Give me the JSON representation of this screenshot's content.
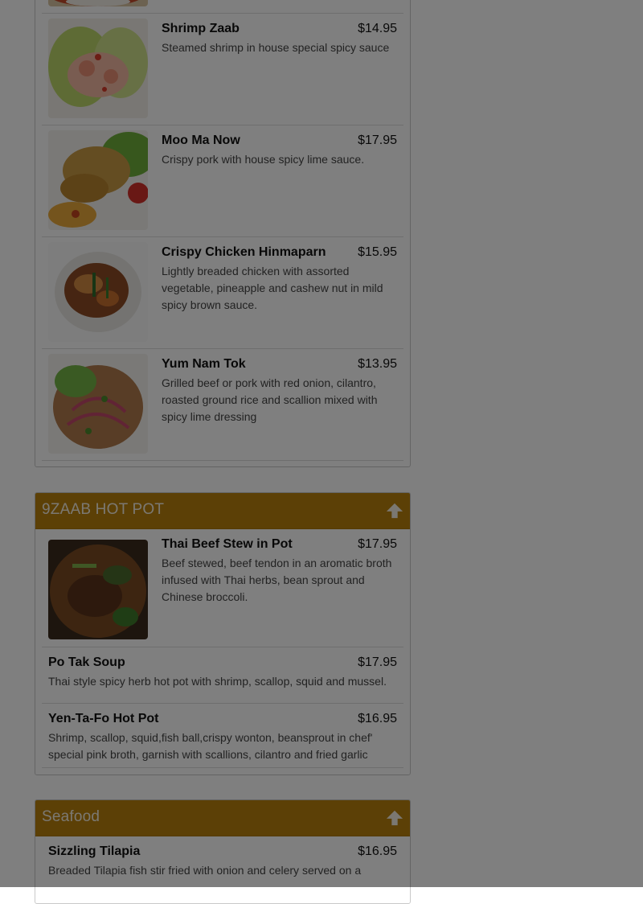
{
  "colors": {
    "accent": "#b8810c",
    "overlay": "rgba(0,0,0,0.5)"
  },
  "panel1": {
    "items": [
      {
        "name": "Shrimp Zaab",
        "price": "$14.95",
        "desc": "Steamed shrimp in house special spicy sauce"
      },
      {
        "name": "Moo Ma Now",
        "price": "$17.95",
        "desc": "Crispy pork with house spicy lime sauce."
      },
      {
        "name": "Crispy Chicken Hinmaparn",
        "price": "$15.95",
        "desc": "Lightly breaded chicken with assorted vegetable, pineapple and cashew nut in mild spicy brown sauce."
      },
      {
        "name": "Yum Nam Tok",
        "price": "$13.95",
        "desc": "Grilled beef or pork with red onion, cilantro, roasted ground rice and scallion mixed with spicy lime dressing"
      }
    ]
  },
  "panel2": {
    "title": "9ZAAB HOT POT",
    "items": [
      {
        "name": "Thai Beef Stew in Pot",
        "price": "$17.95",
        "desc": "Beef stewed, beef tendon in an aromatic broth infused with Thai herbs, bean sprout and Chinese broccoli."
      },
      {
        "name": "Po Tak Soup",
        "price": "$17.95",
        "desc": "Thai style spicy herb hot pot with shrimp, scallop, squid and mussel."
      },
      {
        "name": "Yen-Ta-Fo Hot Pot",
        "price": "$16.95",
        "desc": "Shrimp, scallop, squid,fish ball,crispy wonton, beansprout in chef' special pink broth, garnish with scallions, cilantro and fried garlic"
      }
    ]
  },
  "panel3": {
    "title": "Seafood",
    "items": [
      {
        "name": "Sizzling Tilapia",
        "price": "$16.95",
        "desc": "Breaded Tilapia fish stir fried with onion and celery served on a"
      }
    ]
  },
  "icons": {
    "back_to_top": "arrow-up-icon"
  }
}
